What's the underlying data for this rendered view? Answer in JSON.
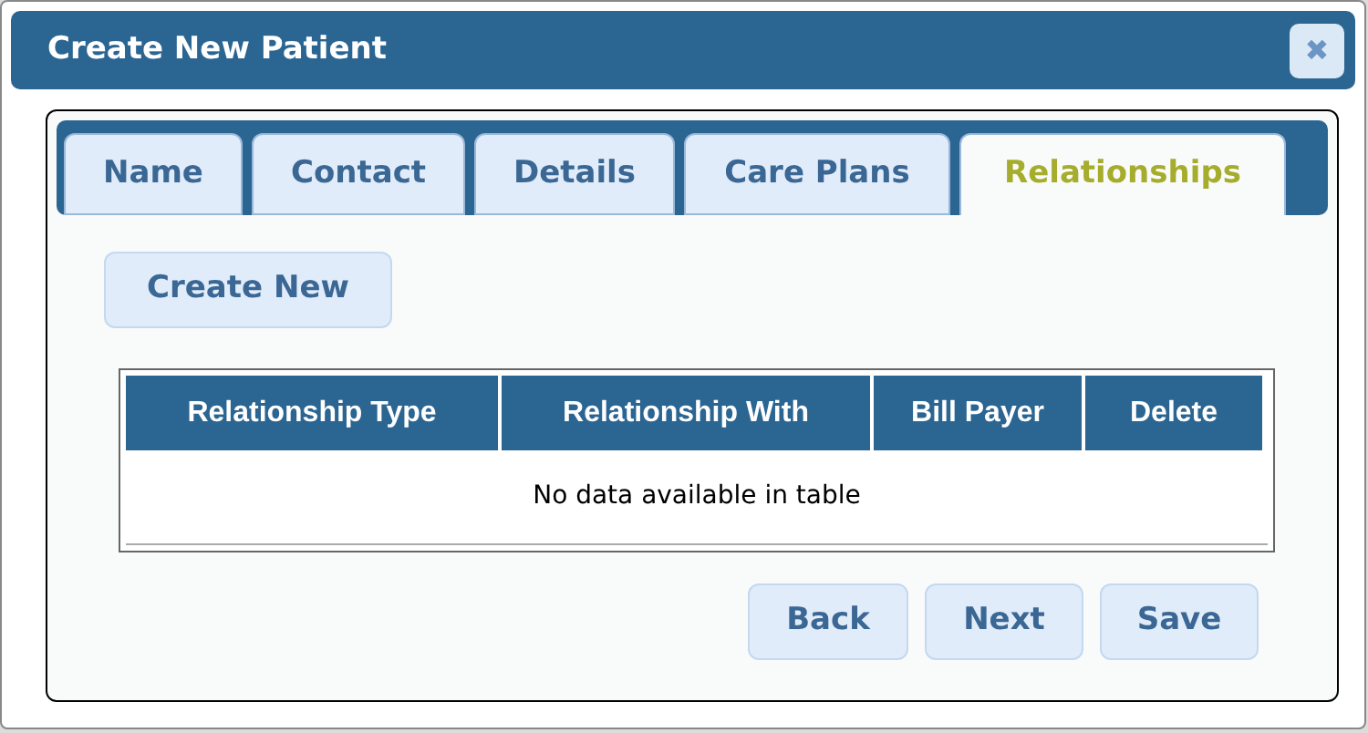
{
  "window": {
    "title": "Create New Patient",
    "close": "✖"
  },
  "tabs": [
    {
      "label": "Name",
      "selected": false
    },
    {
      "label": "Contact",
      "selected": false
    },
    {
      "label": "Details",
      "selected": false
    },
    {
      "label": "Care Plans",
      "selected": false
    },
    {
      "label": "Relationships",
      "selected": true
    }
  ],
  "create_button": "Create New",
  "table": {
    "columns": [
      "Relationship Type",
      "Relationship With",
      "Bill Payer",
      "Delete"
    ],
    "empty_message": "No data available in table"
  },
  "buttons": [
    "Back",
    "Next",
    "Save"
  ]
}
